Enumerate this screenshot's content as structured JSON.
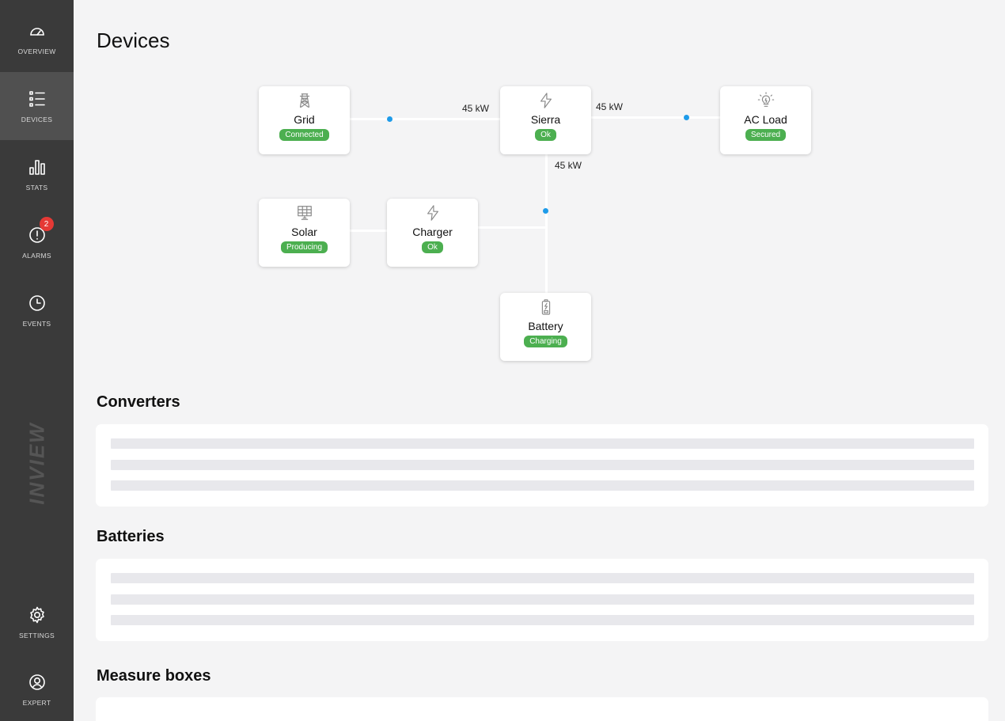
{
  "sidebar": {
    "items": [
      {
        "label": "OVERVIEW",
        "icon": "gauge-icon"
      },
      {
        "label": "DEVICES",
        "icon": "list-icon"
      },
      {
        "label": "STATS",
        "icon": "bar-chart-icon"
      },
      {
        "label": "ALARMS",
        "icon": "alert-circle-icon",
        "badge": "2"
      },
      {
        "label": "EVENTS",
        "icon": "clock-icon"
      },
      {
        "label": "SETTINGS",
        "icon": "gear-icon"
      },
      {
        "label": "EXPERT",
        "icon": "user-circle-icon"
      }
    ],
    "active": "DEVICES",
    "brand": "INVIEW"
  },
  "page": {
    "title": "Devices"
  },
  "diagram": {
    "devices": {
      "grid": {
        "name": "Grid",
        "status": "Connected",
        "icon": "power-tower-icon"
      },
      "sierra": {
        "name": "Sierra",
        "status": "Ok",
        "icon": "bolt-icon"
      },
      "acload": {
        "name": "AC Load",
        "status": "Secured",
        "icon": "lightbulb-icon"
      },
      "solar": {
        "name": "Solar",
        "status": "Producing",
        "icon": "solar-panel-icon"
      },
      "charger": {
        "name": "Charger",
        "status": "Ok",
        "icon": "bolt-icon"
      },
      "battery": {
        "name": "Battery",
        "status": "Charging",
        "icon": "battery-icon"
      }
    },
    "flows": {
      "grid_to_sierra": "45 kW",
      "sierra_to_acload": "45 kW",
      "sierra_to_bus": "45 kW"
    }
  },
  "sections": {
    "converters": "Converters",
    "batteries": "Batteries",
    "measure_boxes": "Measure boxes"
  },
  "colors": {
    "sidebar_bg": "#3a3a3a",
    "sidebar_active": "#505050",
    "status_ok": "#4caf50",
    "flow_dot": "#1e9be9",
    "badge": "#e53935"
  }
}
